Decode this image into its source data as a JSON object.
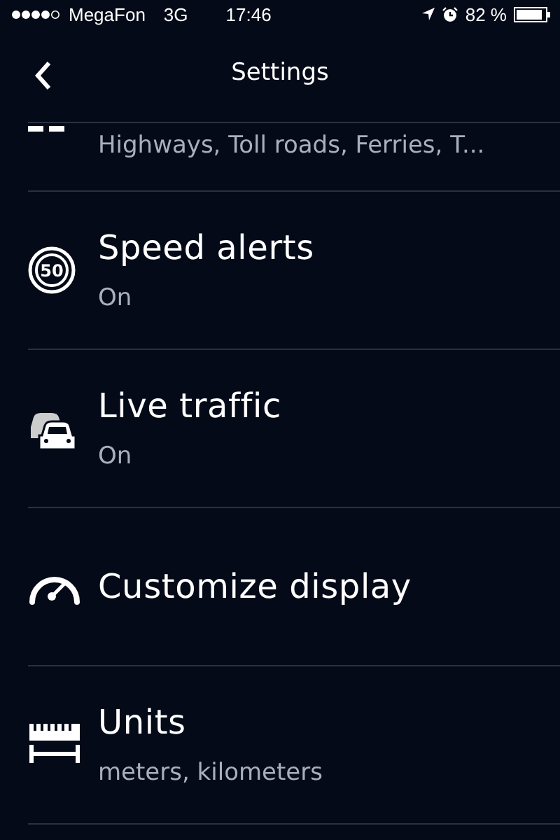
{
  "status_bar": {
    "carrier": "MegaFon",
    "network": "3G",
    "time": "17:46",
    "battery_text": "82 %"
  },
  "nav": {
    "title": "Settings"
  },
  "rows": [
    {
      "kind": "road",
      "subtitle": "Highways, Toll roads, Ferries, T..."
    },
    {
      "kind": "speed",
      "title": "Speed alerts",
      "subtitle": "On",
      "badge": "50"
    },
    {
      "kind": "traffic",
      "title": "Live traffic",
      "subtitle": "On"
    },
    {
      "kind": "gauge",
      "title": "Customize display"
    },
    {
      "kind": "ruler",
      "title": "Units",
      "subtitle": "meters, kilometers"
    }
  ]
}
